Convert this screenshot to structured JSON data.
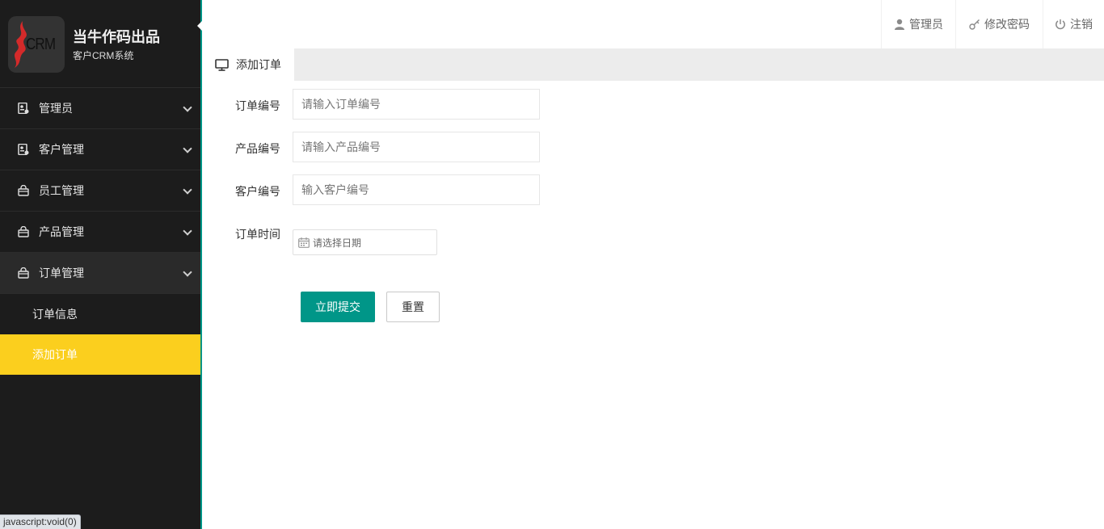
{
  "brand": {
    "logo_text": "CRM",
    "title": "当牛作码出品",
    "subtitle": "客户CRM系统"
  },
  "sidebar": {
    "items": [
      {
        "label": "管理员",
        "icon": "id-card-icon"
      },
      {
        "label": "客户管理",
        "icon": "id-card-icon"
      },
      {
        "label": "员工管理",
        "icon": "basket-icon"
      },
      {
        "label": "产品管理",
        "icon": "basket-icon"
      },
      {
        "label": "订单管理",
        "icon": "basket-icon",
        "expanded": true
      }
    ],
    "sub_items": [
      {
        "label": "订单信息"
      },
      {
        "label": "添加订单",
        "active": true
      }
    ],
    "active_color": "#fbcf1e",
    "accent_color": "#009688"
  },
  "header": {
    "user": "管理员",
    "change_password": "修改密码",
    "logout": "注销"
  },
  "tab": {
    "label": "添加订单"
  },
  "form": {
    "order_no": {
      "label": "订单编号",
      "placeholder": "请输入订单编号"
    },
    "product_no": {
      "label": "产品编号",
      "placeholder": "请输入产品编号"
    },
    "customer_no": {
      "label": "客户编号",
      "placeholder": "输入客户编号"
    },
    "order_time": {
      "label": "订单时间",
      "placeholder": "请选择日期"
    },
    "submit": "立即提交",
    "reset": "重置"
  },
  "status_bar": "javascript:void(0)"
}
